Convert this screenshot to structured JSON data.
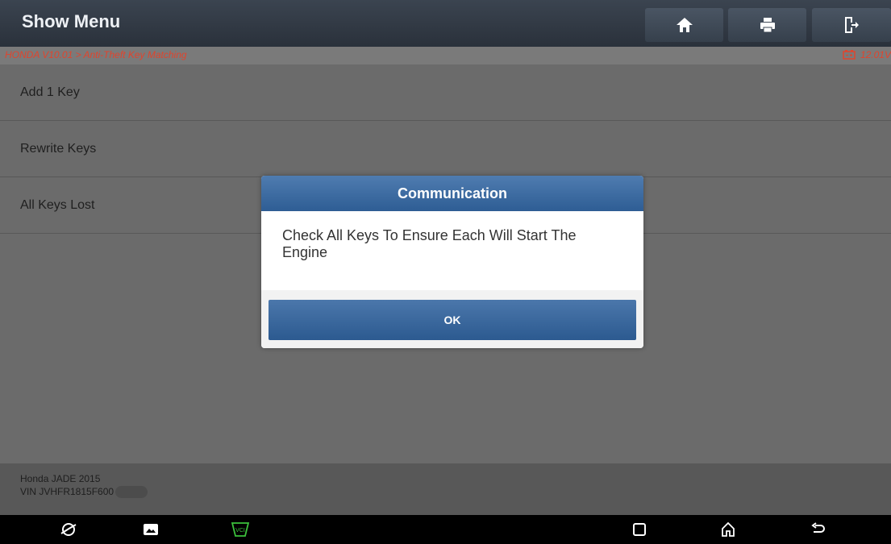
{
  "header": {
    "title": "Show Menu",
    "buttons": [
      {
        "name": "home-icon"
      },
      {
        "name": "print-icon"
      },
      {
        "name": "exit-icon"
      }
    ]
  },
  "breadcrumb": {
    "path": "HONDA V10.01 > Anti-Theft Key Matching",
    "voltage": "12.01V",
    "battery_icon": "battery-icon"
  },
  "menu": {
    "items": [
      {
        "label": "Add 1 Key"
      },
      {
        "label": "Rewrite Keys"
      },
      {
        "label": "All Keys Lost"
      }
    ]
  },
  "footer": {
    "vehicle": "Honda JADE 2015",
    "vin": "VIN JVHFR1815F600"
  },
  "dialog": {
    "title": "Communication",
    "message": "Check All Keys To Ensure Each Will Start The Engine",
    "ok_label": "OK"
  },
  "navbar": {
    "icons": [
      "browser-icon",
      "gallery-icon",
      "vci-icon",
      "recent-apps-icon",
      "home-icon",
      "back-icon"
    ]
  },
  "colors": {
    "header": "#2f3742",
    "crumb_text": "#e0442d",
    "dialog_accent": "#3a6aa2",
    "vci_green": "#3cc23c"
  }
}
